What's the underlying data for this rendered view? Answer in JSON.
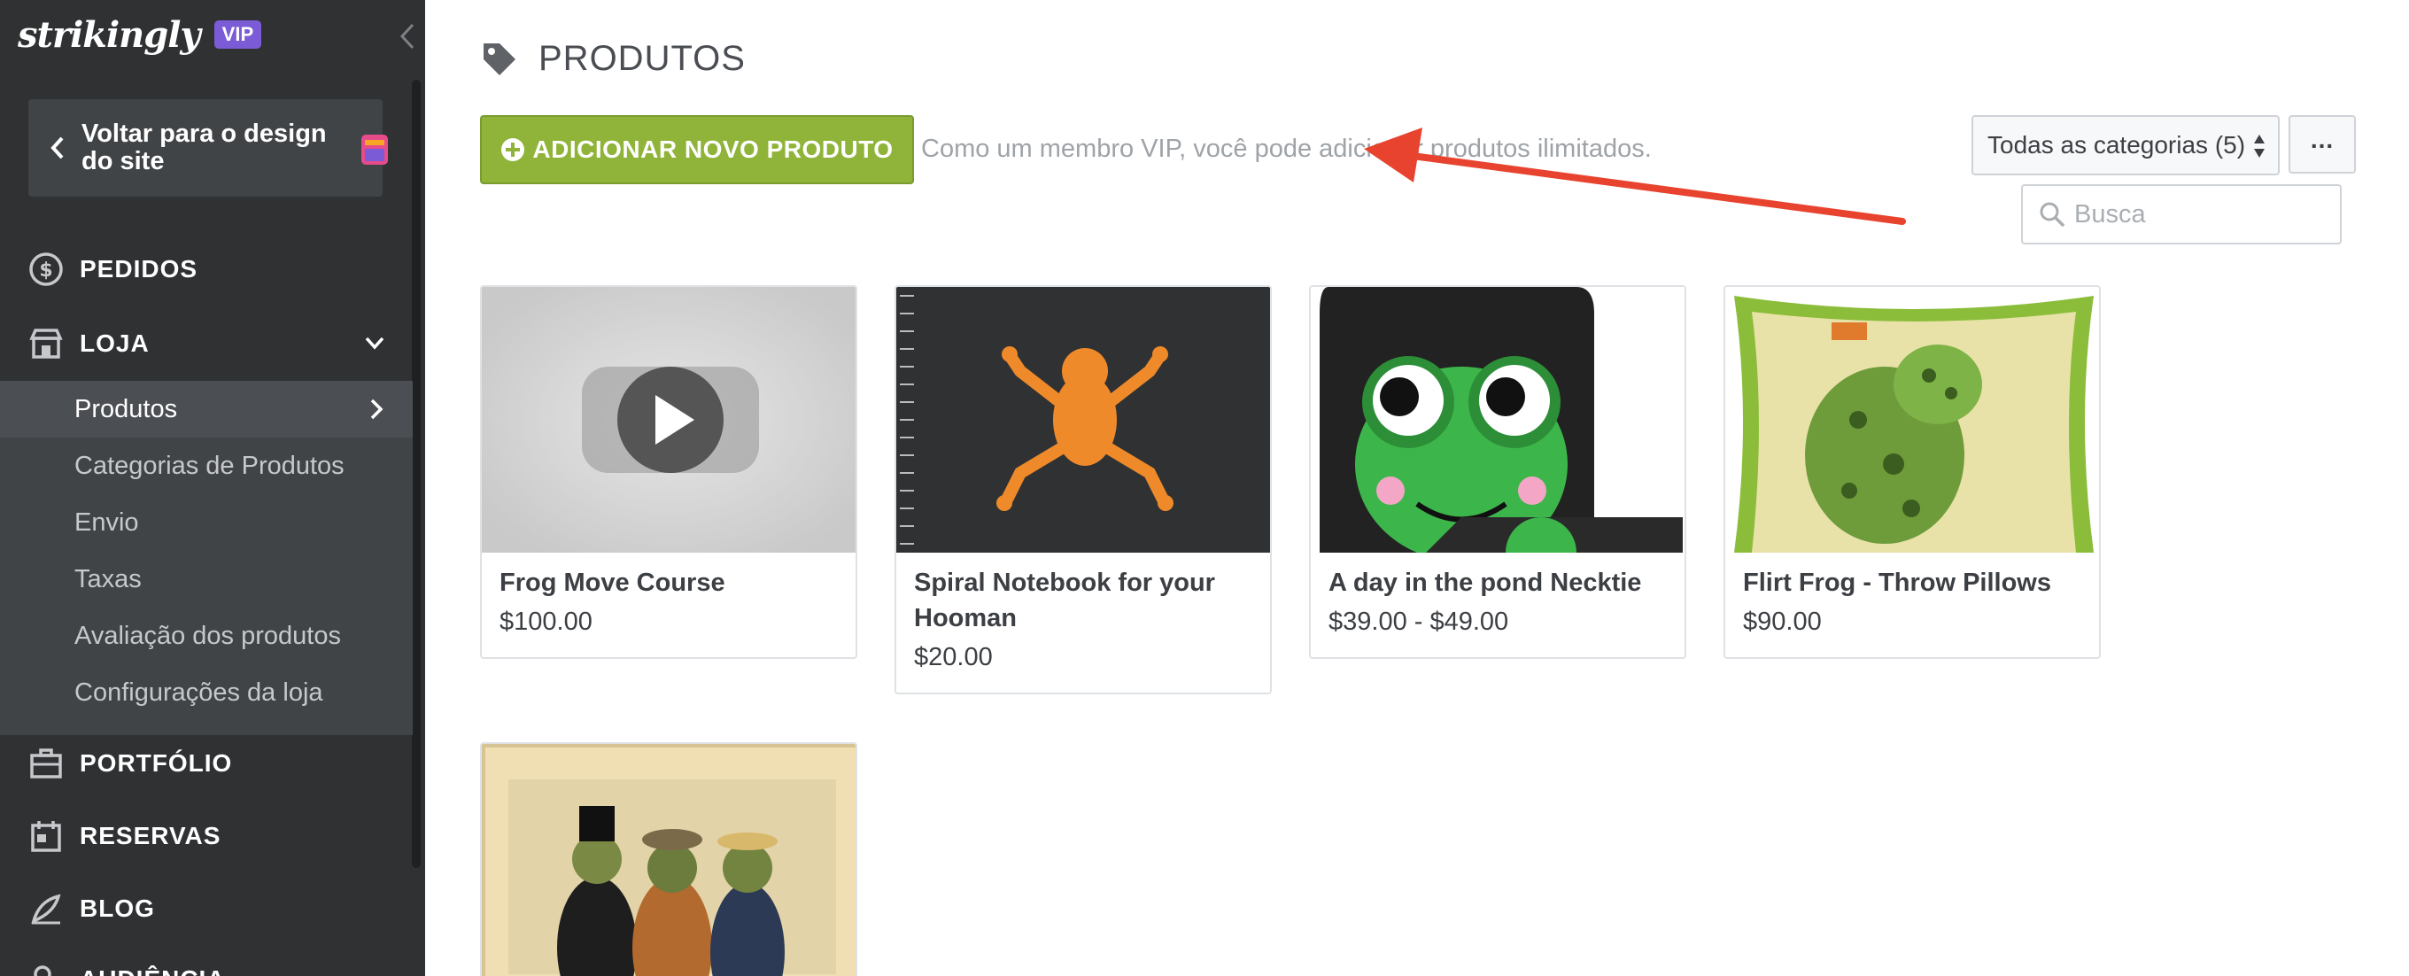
{
  "sidebar": {
    "logo": "strikingly",
    "vip_badge": "VIP",
    "back_label": "Voltar para o design do site",
    "nav": [
      {
        "label": "PEDIDOS",
        "icon": "dollar-circle-icon"
      },
      {
        "label": "LOJA",
        "icon": "store-icon"
      },
      {
        "label": "PORTFÓLIO",
        "icon": "briefcase-icon"
      },
      {
        "label": "RESERVAS",
        "icon": "calendar-icon"
      },
      {
        "label": "BLOG",
        "icon": "pen-icon"
      },
      {
        "label": "AUDIÊNCIA",
        "icon": "users-icon"
      }
    ],
    "store_sub": [
      {
        "label": "Produtos"
      },
      {
        "label": "Categorias de Produtos"
      },
      {
        "label": "Envio"
      },
      {
        "label": "Taxas"
      },
      {
        "label": "Avaliação dos produtos"
      },
      {
        "label": "Configurações da loja"
      }
    ]
  },
  "main": {
    "title": "PRODUTOS",
    "add_button": "ADICIONAR NOVO PRODUTO",
    "info": "Como um membro VIP, você pode adicionar produtos ilimitados.",
    "category_select": "Todas as categorias (5)",
    "more_button": "...",
    "search_placeholder": "Busca"
  },
  "products": [
    {
      "name": "Frog Move Course",
      "price": "$100.00"
    },
    {
      "name": "Spiral Notebook for your Hooman",
      "price": "$20.00"
    },
    {
      "name": "A day in the pond Necktie",
      "price": "$39.00 - $49.00"
    },
    {
      "name": "Flirt Frog - Throw Pillows",
      "price": "$90.00"
    },
    {
      "name": "",
      "price": ""
    }
  ],
  "colors": {
    "sidebar_bg": "#2f3133",
    "add_button": "#8fb439",
    "vip_badge": "#7b5cd6",
    "annotation_arrow": "#e8432e"
  }
}
